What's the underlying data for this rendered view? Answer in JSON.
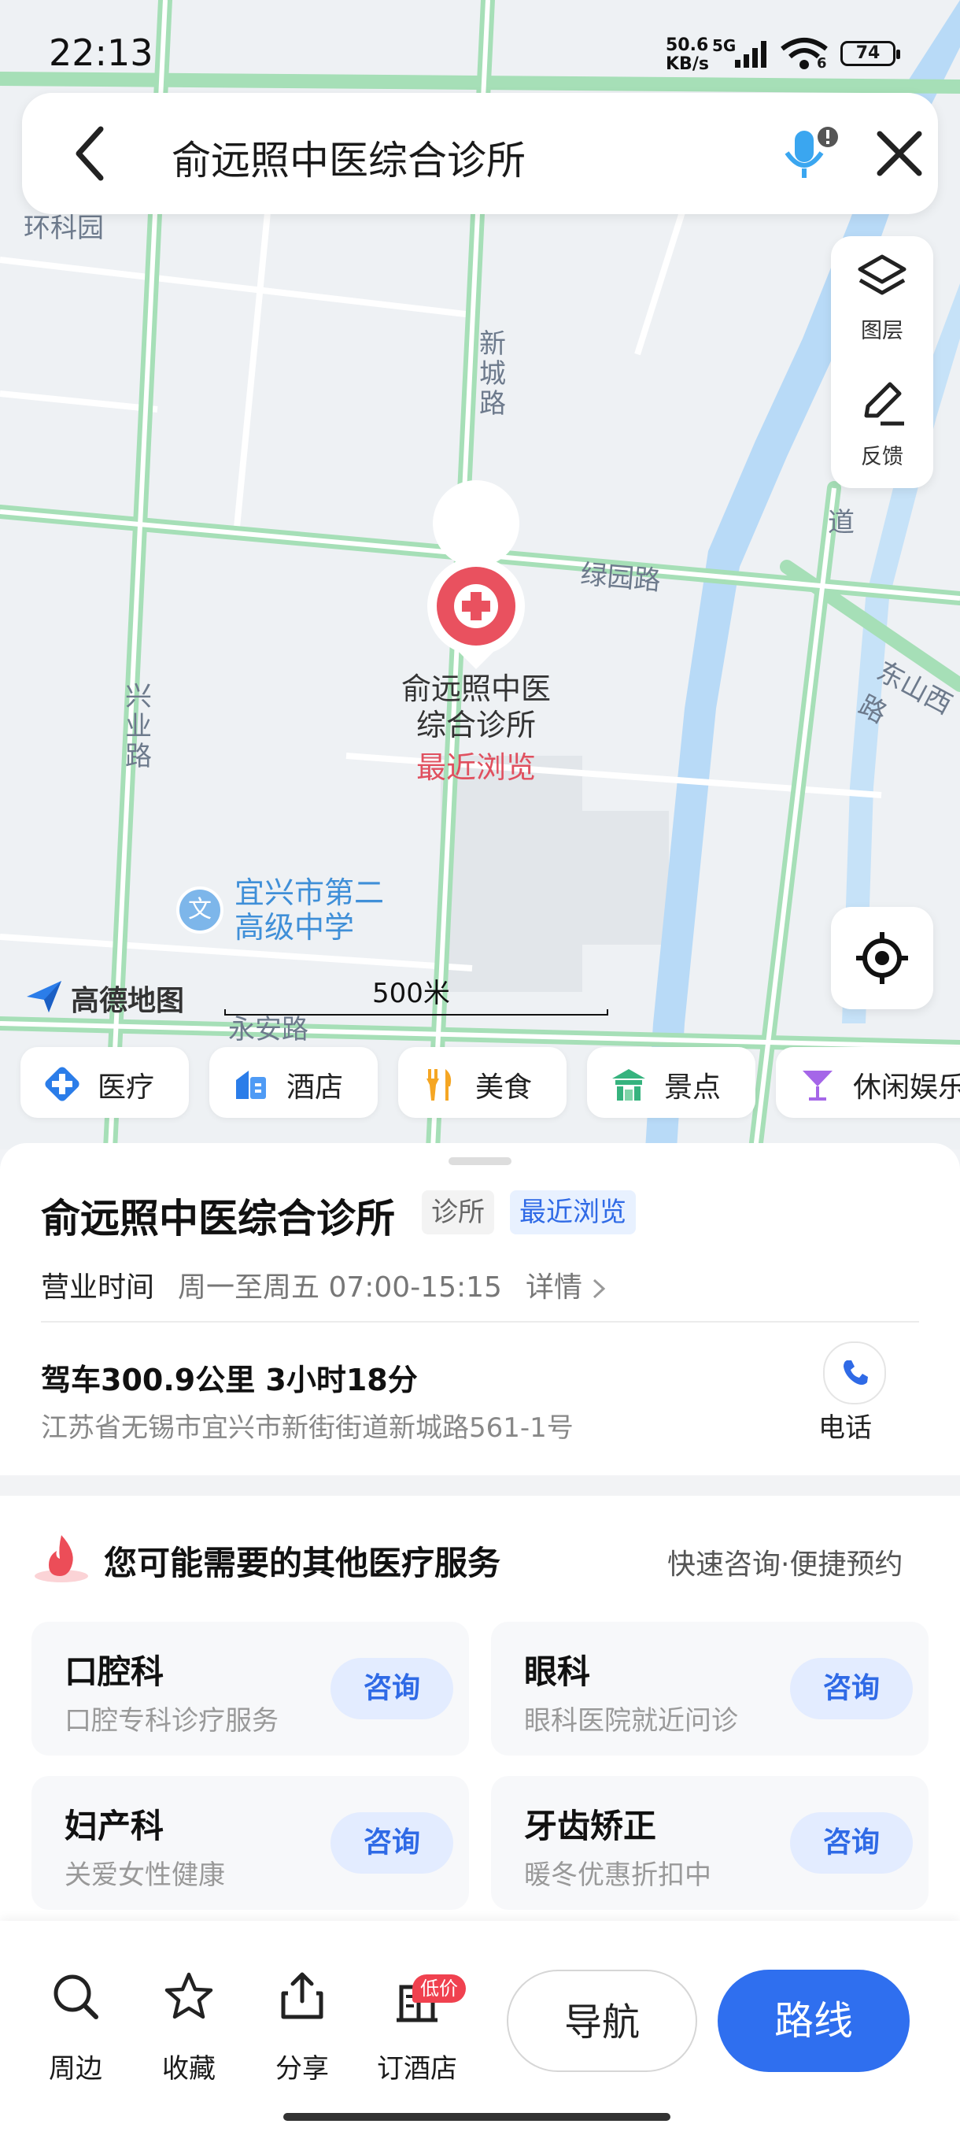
{
  "status_bar": {
    "time": "22:13",
    "net_speed_value": "50.6",
    "net_speed_unit": "KB/s",
    "network": "5G",
    "signal_sub": "6",
    "battery": "74"
  },
  "search": {
    "query": "俞远照中医综合诊所"
  },
  "map": {
    "side_panel": {
      "layers_label": "图层",
      "feedback_label": "反馈"
    },
    "road_labels": {
      "ring_park": "环科园",
      "xincheng_road": "新城路",
      "lvyuan_road": "绿园路",
      "xingye_road": "兴业路",
      "dongshan_west": "东山西路",
      "yongan_road": "永安路",
      "dao": "道"
    },
    "poi": {
      "name_line1": "俞远照中医",
      "name_line2": "综合诊所",
      "recent": "最近浏览"
    },
    "school": {
      "icon_text": "文",
      "name_line1": "宜兴市第二",
      "name_line2": "高级中学"
    },
    "logo": "高德地图",
    "scale": "500米",
    "colors": {
      "road": "#a6dfb7",
      "water": "#b8daf7",
      "poi": "#e9515f"
    }
  },
  "categories": [
    {
      "label": "医疗",
      "icon": "medical-cross-icon"
    },
    {
      "label": "酒店",
      "icon": "hotel-icon"
    },
    {
      "label": "美食",
      "icon": "food-icon"
    },
    {
      "label": "景点",
      "icon": "attraction-icon"
    },
    {
      "label": "休闲娱乐",
      "icon": "cocktail-icon"
    }
  ],
  "place": {
    "title": "俞远照中医综合诊所",
    "tag_type": "诊所",
    "tag_recent": "最近浏览",
    "hours_label": "营业时间",
    "hours_value": "周一至周五 07:00-15:15",
    "detail_label": "详情",
    "drive_info": "驾车300.9公里 3小时18分",
    "address": "江苏省无锡市宜兴市新街街道新城路561-1号",
    "phone_label": "电话"
  },
  "services": {
    "title": "您可能需要的其他医疗服务",
    "subtitle": "快速咨询·便捷预约",
    "items": [
      {
        "name": "口腔科",
        "desc": "口腔专科诊疗服务",
        "button": "咨询"
      },
      {
        "name": "眼科",
        "desc": "眼科医院就近问诊",
        "button": "咨询"
      },
      {
        "name": "妇产科",
        "desc": "关爱女性健康",
        "button": "咨询"
      },
      {
        "name": "牙齿矫正",
        "desc": "暖冬优惠折扣中",
        "button": "咨询"
      }
    ]
  },
  "bottom_bar": {
    "nearby": "周边",
    "favorite": "收藏",
    "share": "分享",
    "book_hotel": "订酒店",
    "low_price_badge": "低价",
    "navigate": "导航",
    "route": "路线"
  }
}
